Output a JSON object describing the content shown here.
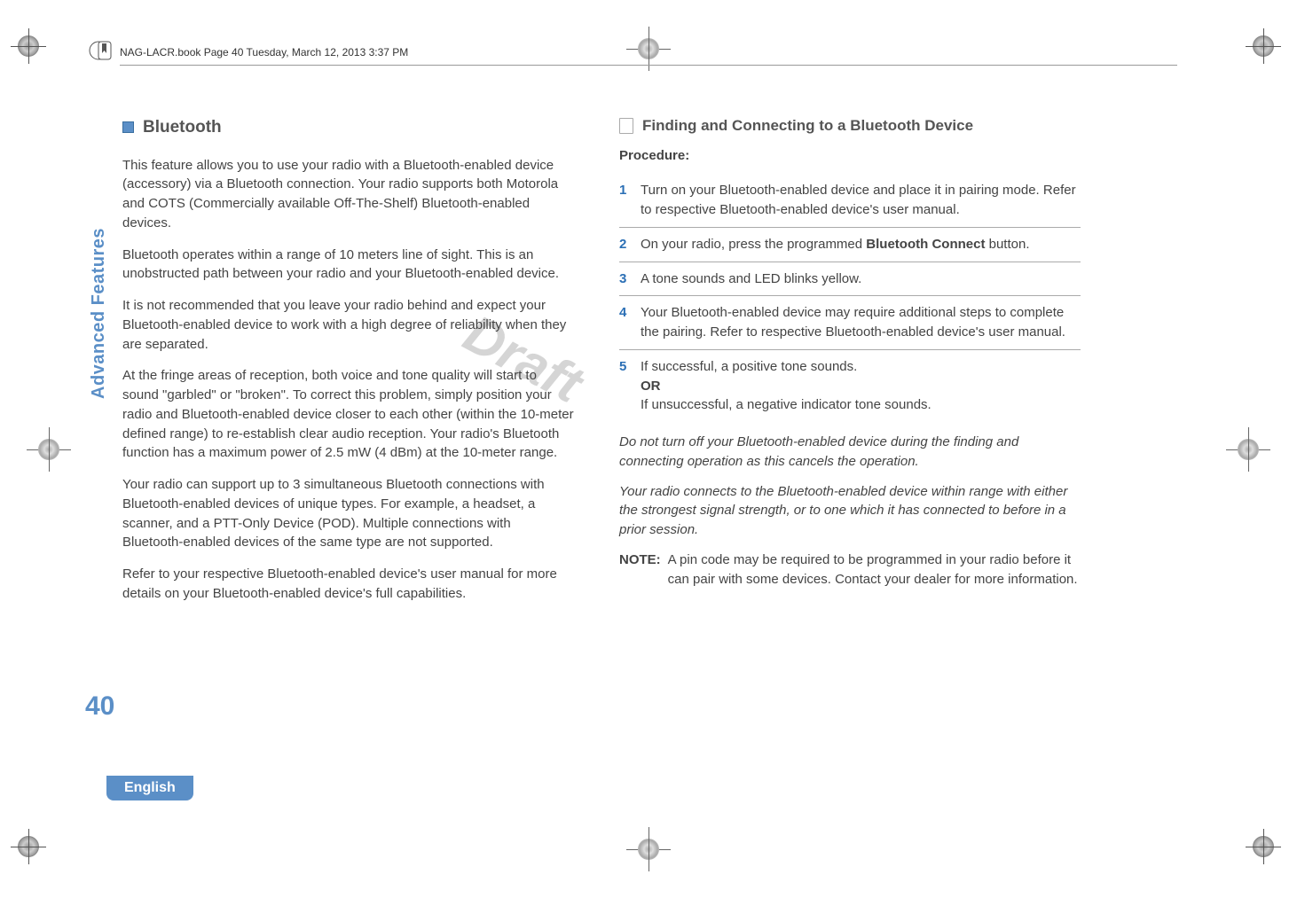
{
  "header": {
    "filename_line": "NAG-LACR.book  Page 40  Tuesday, March 12, 2013  3:37 PM"
  },
  "watermark": "Draft",
  "side_tab": "Advanced Features",
  "page_number": "40",
  "language": "English",
  "left_column": {
    "heading": "Bluetooth",
    "p1": "This feature allows you to use your radio with a Bluetooth-enabled device (accessory) via a Bluetooth connection. Your radio supports both Motorola and COTS (Commercially available Off-The-Shelf) Bluetooth-enabled devices.",
    "p2": "Bluetooth operates within a range of 10 meters line of sight. This is an unobstructed path between your radio and your Bluetooth-enabled device.",
    "p3": "It is not recommended that you leave your radio behind and expect your Bluetooth-enabled device to work with a high degree of reliability when they are separated.",
    "p4": "At the fringe areas of reception, both voice and tone quality will start to sound \"garbled\" or \"broken\". To correct this problem, simply position your radio and Bluetooth-enabled device closer to each other (within the 10-meter defined range) to re-establish clear audio reception. Your radio's Bluetooth function has a maximum power of 2.5 mW (4 dBm) at the 10-meter range.",
    "p5": "Your radio can support up to 3 simultaneous Bluetooth connections with Bluetooth-enabled devices of unique types. For example, a headset, a scanner, and a PTT-Only Device (POD). Multiple connections with Bluetooth-enabled devices of the same type are not supported.",
    "p6": "Refer to your respective Bluetooth-enabled device's user manual for more details on your Bluetooth-enabled device's full capabilities."
  },
  "right_column": {
    "sub_heading": "Finding and Connecting to a Bluetooth Device",
    "procedure_label": "Procedure:",
    "steps": [
      {
        "num": "1",
        "text": "Turn on your Bluetooth-enabled device and place it in pairing mode. Refer to respective Bluetooth-enabled device's user manual."
      },
      {
        "num": "2",
        "text_before": "On your radio, press the programmed ",
        "bold": "Bluetooth Connect",
        "text_after": " button."
      },
      {
        "num": "3",
        "text": "A tone sounds and LED blinks yellow."
      },
      {
        "num": "4",
        "text": "Your Bluetooth-enabled device may require additional steps to complete the pairing. Refer to respective Bluetooth-enabled device's user manual."
      },
      {
        "num": "5",
        "line1": "If successful, a positive tone sounds.",
        "or": "OR",
        "line2": "If unsuccessful, a negative indicator tone sounds."
      }
    ],
    "italic1": "Do not turn off your Bluetooth-enabled device during the finding and connecting operation as this cancels the operation.",
    "italic2": "Your radio connects to the Bluetooth-enabled device within range with either the strongest signal strength, or to one which it has connected to before in a prior session.",
    "note_label": "NOTE:",
    "note_text": "A pin code may be required to be programmed in your radio before it can pair with some devices. Contact your dealer for more information."
  }
}
